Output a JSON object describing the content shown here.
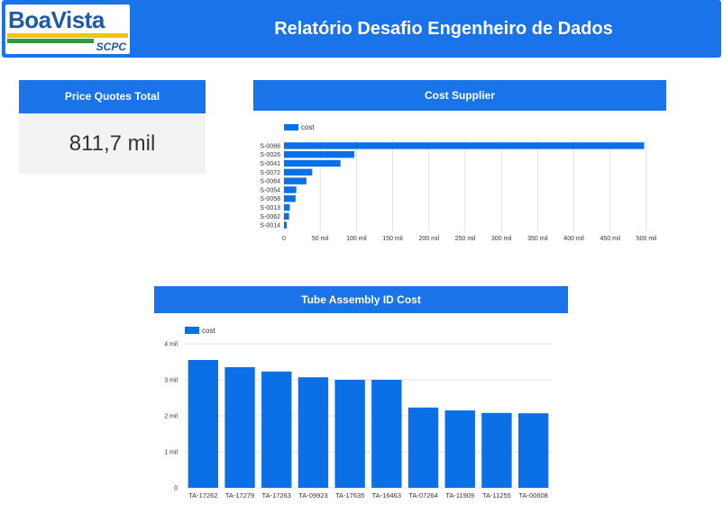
{
  "header": {
    "logo_text": "BoaVista",
    "logo_sub": "SCPC",
    "title": "Relatório Desafio Engenheiro de Dados"
  },
  "kpi": {
    "label": "Price Quotes Total",
    "value": "811,7 mil"
  },
  "colors": {
    "accent": "#1a73e8",
    "bar": "#0b6fe6"
  },
  "chart_data": [
    {
      "type": "bar",
      "orientation": "horizontal",
      "title": "Cost Supplier",
      "legend": "cost",
      "legend_position": "top-left",
      "categories": [
        "S-0066",
        "S-0026",
        "S-0041",
        "S-0072",
        "S-0064",
        "S-0054",
        "S-0058",
        "S-0013",
        "S-0062",
        "S-0014"
      ],
      "values": [
        497000,
        97000,
        78000,
        39000,
        31000,
        17000,
        16000,
        8000,
        7000,
        4000
      ],
      "xlim": [
        0,
        500000
      ],
      "ticks": [
        0,
        50000,
        100000,
        150000,
        200000,
        250000,
        300000,
        350000,
        400000,
        450000,
        500000
      ],
      "tick_labels": [
        "0",
        "50 mil",
        "100 mil",
        "150 mil",
        "200 mil",
        "250 mil",
        "300 mil",
        "350 mil",
        "400 mil",
        "450 mil",
        "500 mil"
      ],
      "grid": true
    },
    {
      "type": "bar",
      "orientation": "vertical",
      "title": "Tube Assembly ID Cost",
      "legend": "cost",
      "legend_position": "top-left",
      "categories": [
        "TA-17262",
        "TA-17279",
        "TA-17263",
        "TA-09923",
        "TA-17635",
        "TA-16463",
        "TA-07264",
        "TA-11909",
        "TA-11255",
        "TA-00608"
      ],
      "values": [
        3550,
        3350,
        3230,
        3070,
        3000,
        3000,
        2230,
        2150,
        2080,
        2070
      ],
      "ylim": [
        0,
        4000
      ],
      "ticks": [
        0,
        1000,
        2000,
        3000,
        4000
      ],
      "tick_labels": [
        "0",
        "1 mil",
        "2 mil",
        "3 mil",
        "4 mil"
      ],
      "grid": true
    }
  ]
}
